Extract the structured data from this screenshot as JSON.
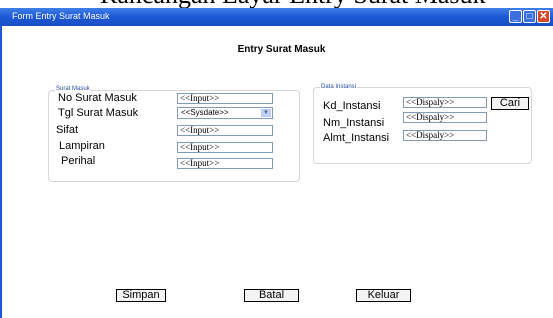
{
  "caption": "Rancangan Layar Entry Surat Masuk",
  "window": {
    "title": "Form Entry Surat Masuk",
    "minimize_glyph": "_",
    "maximize_glyph": "□",
    "close_glyph": "✕"
  },
  "heading": "Entry Surat Masuk",
  "surat_masuk": {
    "legend": "Surat Masuk",
    "fields": [
      {
        "label": "No Surat Masuk",
        "value": "<<Input>>"
      },
      {
        "label": "Tgl Surat Masuk",
        "value": "<<Sysdate>>"
      },
      {
        "label": "Sifat",
        "value": "<<Input>>"
      },
      {
        "label": "Lampiran",
        "value": "<<Input>>"
      },
      {
        "label": "Perihal",
        "value": "<<Input>>"
      }
    ]
  },
  "data_instansi": {
    "legend": "Data Instansi",
    "fields": [
      {
        "label": "Kd_Instansi",
        "value": "<<Dispaly>>"
      },
      {
        "label": "Nm_Instansi",
        "value": "<<Dispaly>>"
      },
      {
        "label": "Almt_Instansi",
        "value": "<<Dispaly>>"
      }
    ],
    "search_button": "Cari"
  },
  "buttons": {
    "save": "Simpan",
    "cancel": "Batal",
    "exit": "Keluar"
  }
}
